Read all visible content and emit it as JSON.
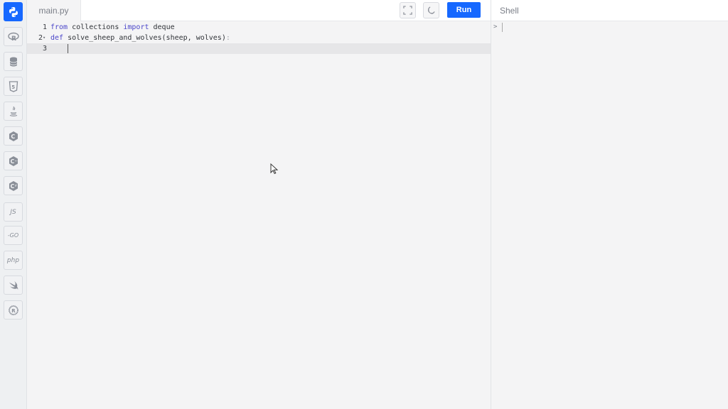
{
  "sidebar": {
    "items": [
      {
        "name": "python",
        "icon": "python-icon",
        "active": true
      },
      {
        "name": "r",
        "icon": "r-icon"
      },
      {
        "name": "sql",
        "icon": "database-icon"
      },
      {
        "name": "html",
        "icon": "html5-icon"
      },
      {
        "name": "java",
        "icon": "java-icon"
      },
      {
        "name": "c",
        "icon": "c-icon"
      },
      {
        "name": "cpp",
        "icon": "cpp-icon"
      },
      {
        "name": "csharp",
        "icon": "csharp-icon"
      },
      {
        "name": "javascript",
        "label": "JS"
      },
      {
        "name": "go",
        "label": "-GO"
      },
      {
        "name": "php",
        "label": "php"
      },
      {
        "name": "swift",
        "icon": "swift-icon"
      },
      {
        "name": "rust",
        "icon": "rust-icon"
      }
    ]
  },
  "editor": {
    "file_tab": "main.py",
    "run_label": "Run",
    "lines": [
      {
        "num": "1",
        "kw1": "from",
        "t1": " collections ",
        "kw2": "import",
        "t2": " deque"
      },
      {
        "num": "2",
        "kw1": "def",
        "t1": " solve_sheep_and_wolves(sheep, wolves)",
        "t2": ":"
      },
      {
        "num": "3"
      }
    ]
  },
  "shell": {
    "title": "Shell",
    "prompt": ">"
  },
  "colors": {
    "accent": "#1668ff",
    "keyword": "#4a45c9"
  }
}
